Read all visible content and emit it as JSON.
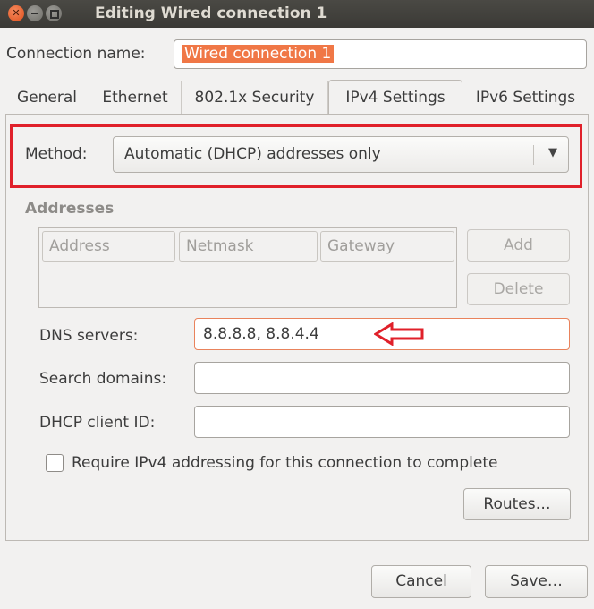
{
  "window": {
    "title": "Editing Wired connection 1"
  },
  "connection_name": {
    "label": "Connection name:",
    "value": "Wired connection 1"
  },
  "tabs": [
    {
      "label": "General"
    },
    {
      "label": "Ethernet"
    },
    {
      "label": "802.1x Security"
    },
    {
      "label": "IPv4 Settings",
      "active": true
    },
    {
      "label": "IPv6 Settings"
    }
  ],
  "method": {
    "label": "Method:",
    "value": "Automatic (DHCP) addresses only"
  },
  "addresses": {
    "section_label": "Addresses",
    "columns": [
      "Address",
      "Netmask",
      "Gateway"
    ],
    "add_label": "Add",
    "delete_label": "Delete"
  },
  "dns": {
    "label": "DNS servers:",
    "value": "8.8.8.8, 8.8.4.4"
  },
  "search_domains": {
    "label": "Search domains:",
    "value": ""
  },
  "dhcp_client_id": {
    "label": "DHCP client ID:",
    "value": ""
  },
  "require_ipv4": {
    "label": "Require IPv4 addressing for this connection to complete",
    "checked": false
  },
  "routes_label": "Routes…",
  "footer": {
    "cancel_label": "Cancel",
    "save_label": "Save…"
  },
  "colors": {
    "highlight": "#e0202a",
    "selection": "#f07746",
    "titlebar": "#3c3b37"
  }
}
